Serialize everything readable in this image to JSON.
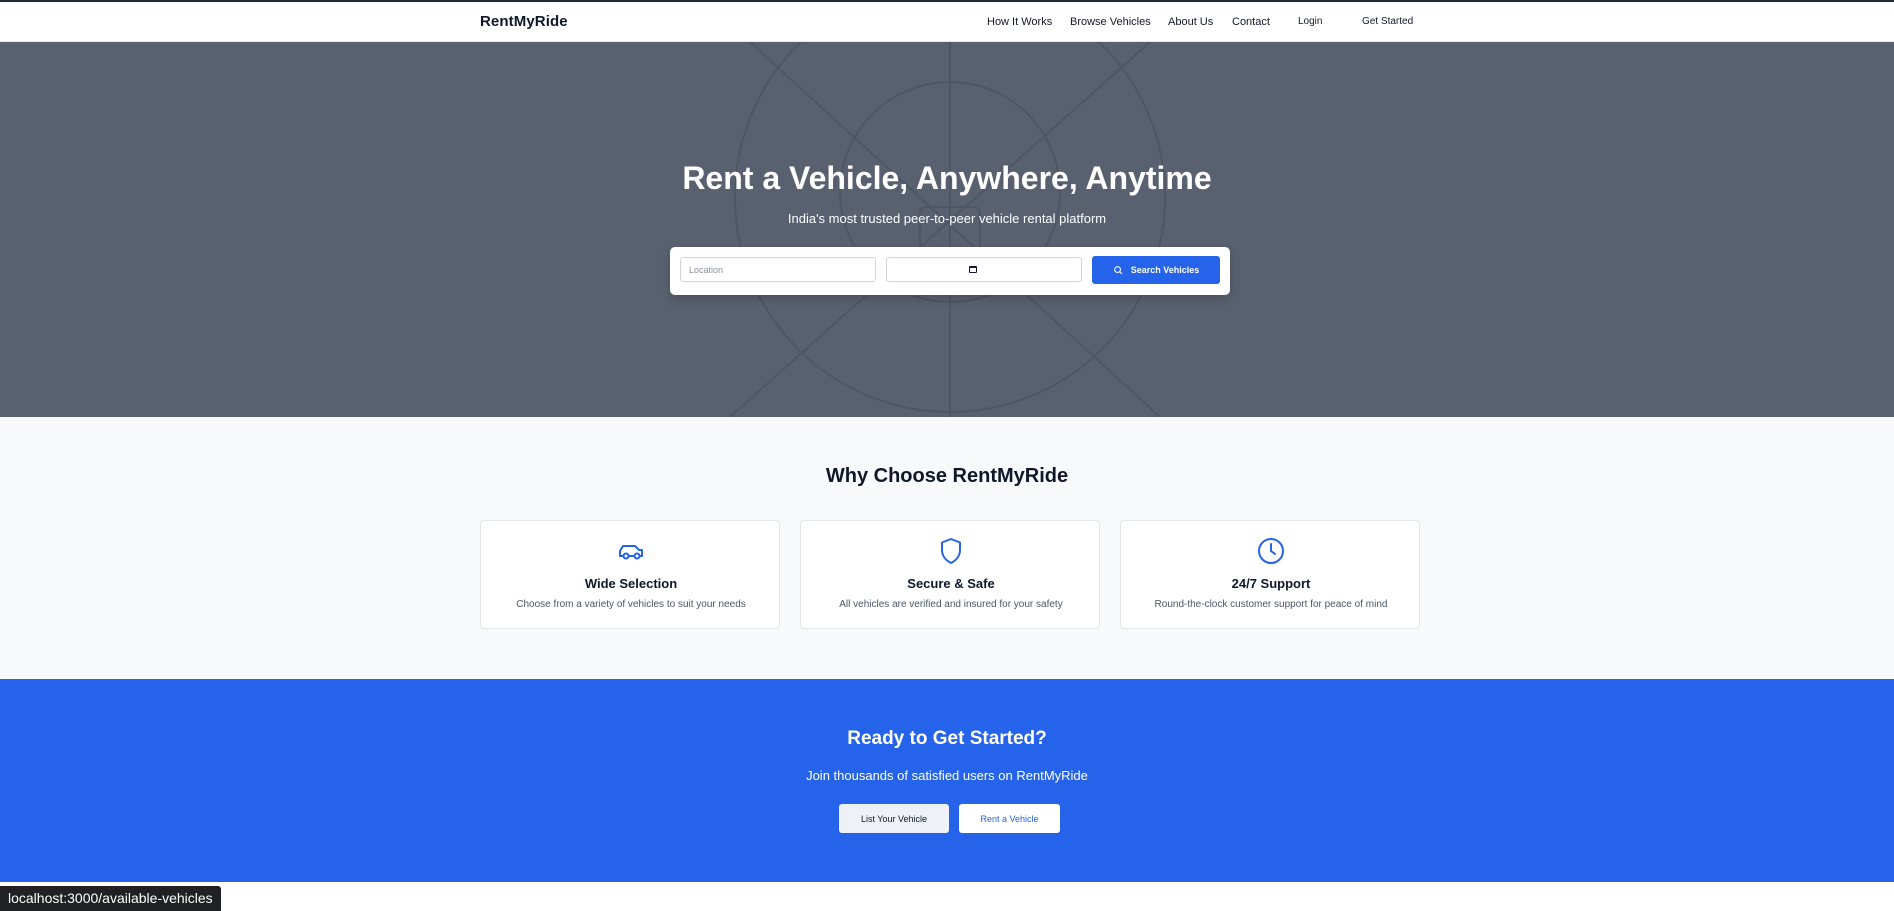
{
  "nav": {
    "brand": "RentMyRide",
    "links": [
      "How It Works",
      "Browse Vehicles",
      "About Us",
      "Contact"
    ],
    "login": "Login",
    "get_started": "Get Started"
  },
  "hero": {
    "title": "Rent a Vehicle, Anywhere, Anytime",
    "subtitle": "India's most trusted peer-to-peer vehicle rental platform",
    "search": {
      "location_placeholder": "Location",
      "button_label": "Search Vehicles",
      "button_icon": "search-icon"
    }
  },
  "features": {
    "title": "Why Choose RentMyRide",
    "cards": [
      {
        "icon": "car-icon",
        "title": "Wide Selection",
        "description": "Choose from a variety of vehicles to suit your needs"
      },
      {
        "icon": "shield-icon",
        "title": "Secure & Safe",
        "description": "All vehicles are verified and insured for your safety"
      },
      {
        "icon": "clock-icon",
        "title": "24/7 Support",
        "description": "Round-the-clock customer support for peace of mind"
      }
    ]
  },
  "cta": {
    "title": "Ready to Get Started?",
    "subtitle": "Join thousands of satisfied users on RentMyRide",
    "list_button": "List Your Vehicle",
    "rent_button": "Rent a Vehicle"
  },
  "status_bar": {
    "url": "localhost:3000/available-vehicles"
  },
  "colors": {
    "primary": "#2563eb",
    "hero_overlay": "#596170",
    "features_bg": "#f8f9fb",
    "text_dark": "#0f172a"
  }
}
